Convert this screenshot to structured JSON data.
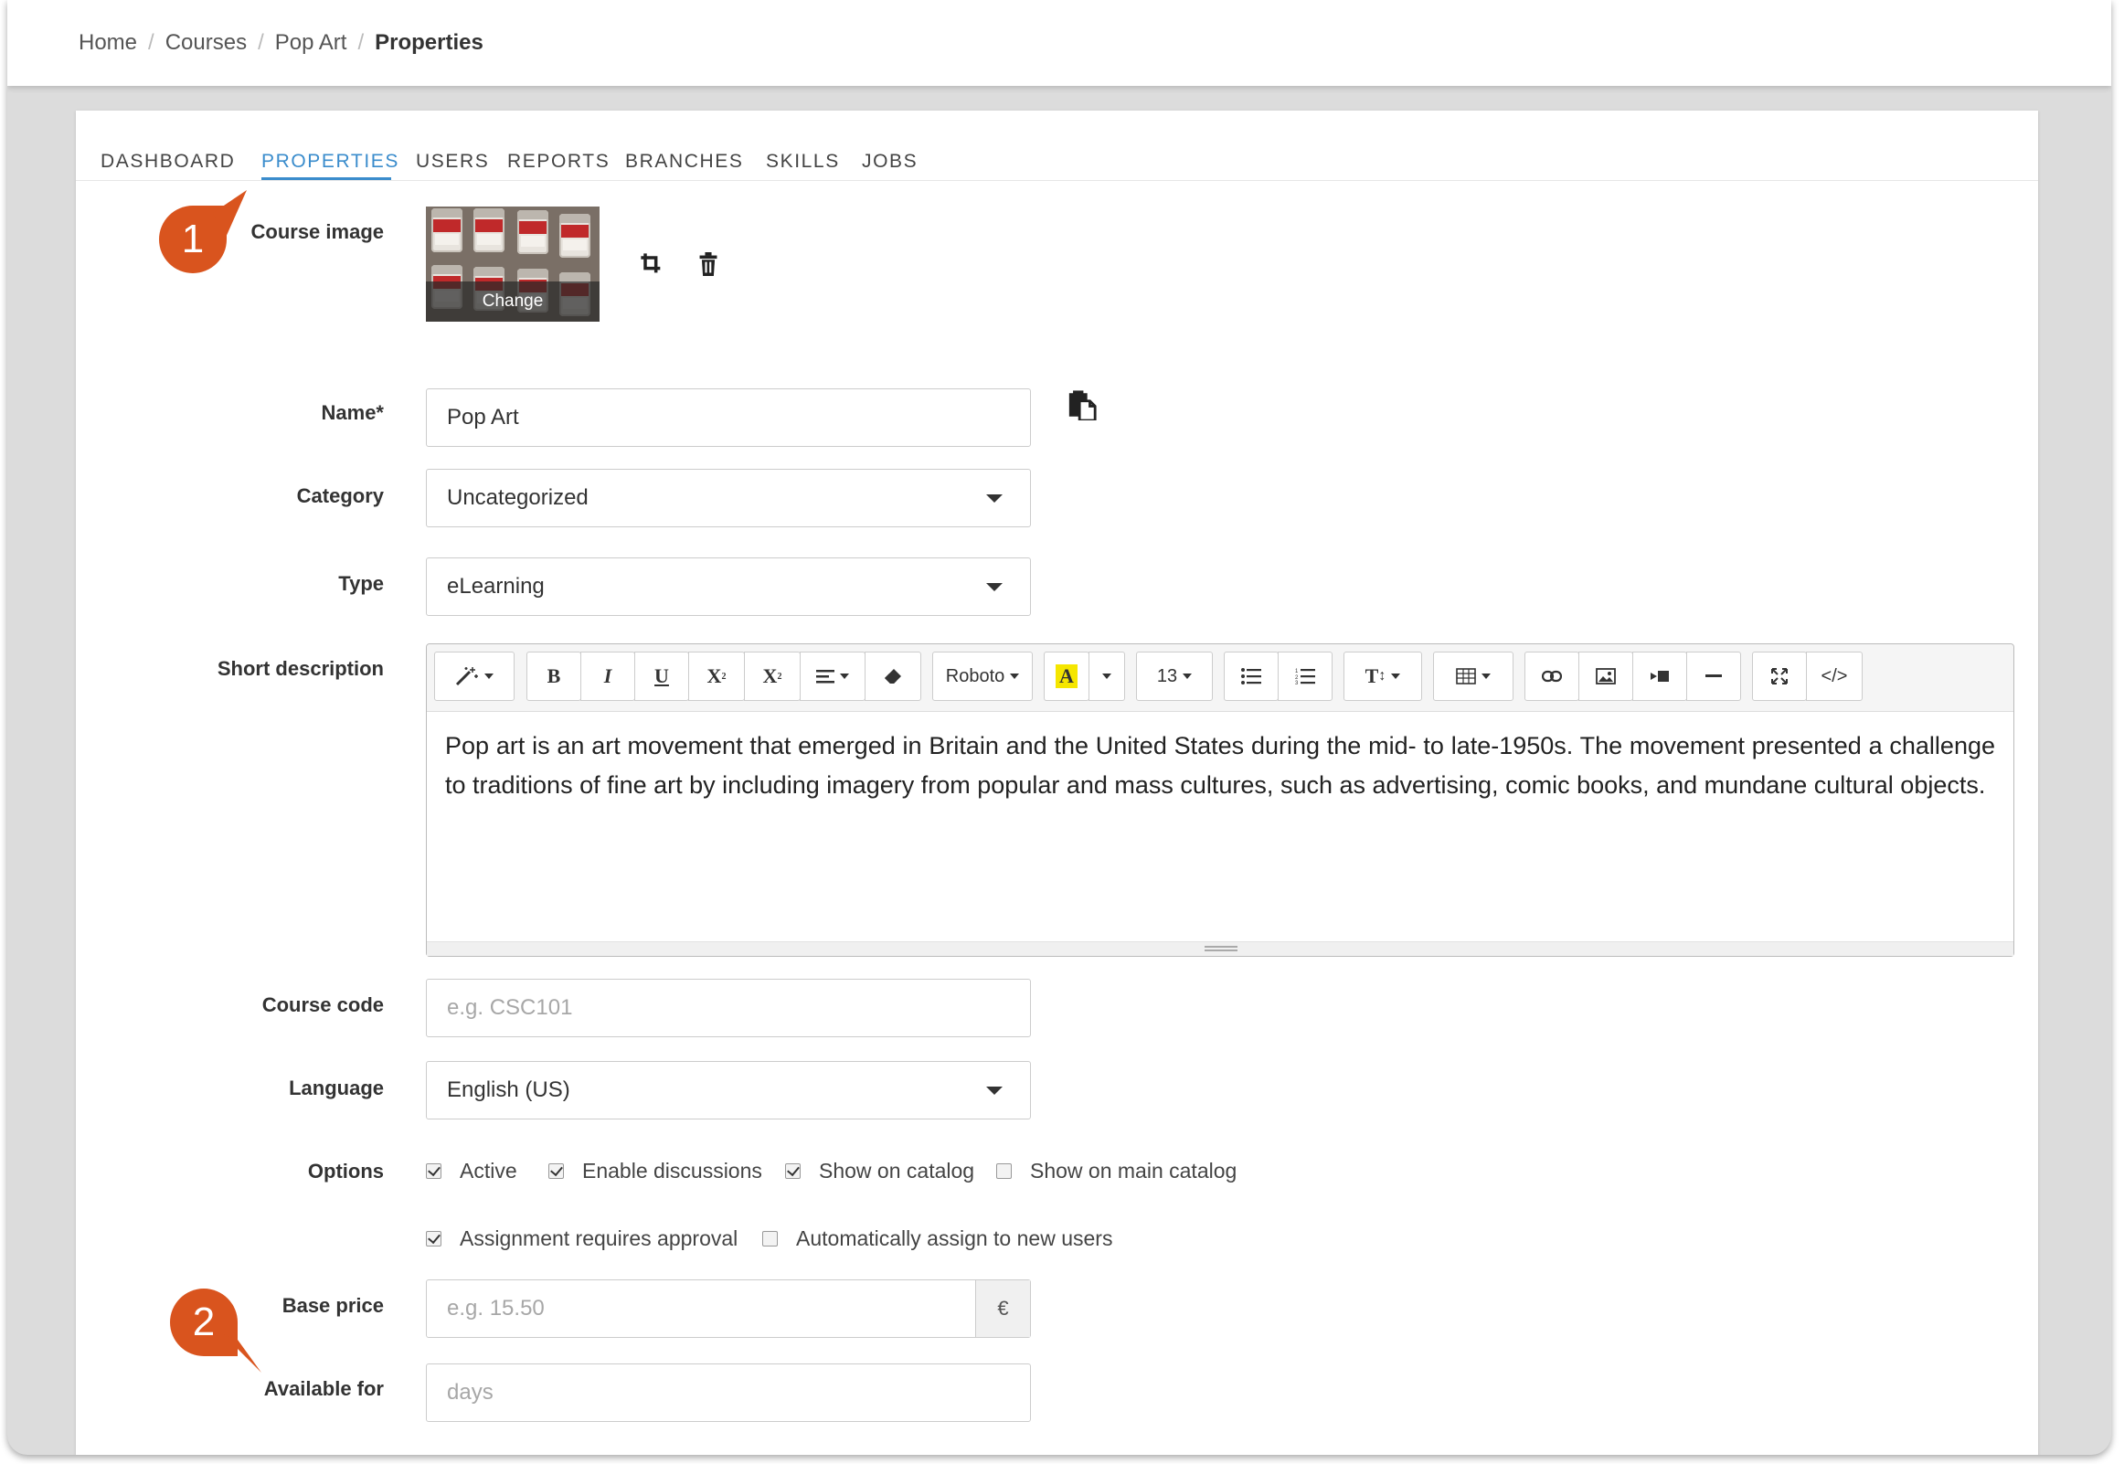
{
  "breadcrumb": {
    "items": [
      "Home",
      "Courses",
      "Pop Art"
    ],
    "current": "Properties",
    "separator": "/"
  },
  "tabs": [
    {
      "label": "DASHBOARD",
      "active": false
    },
    {
      "label": "PROPERTIES",
      "active": true
    },
    {
      "label": "USERS",
      "active": false
    },
    {
      "label": "REPORTS",
      "active": false
    },
    {
      "label": "BRANCHES",
      "active": false
    },
    {
      "label": "SKILLS",
      "active": false
    },
    {
      "label": "JOBS",
      "active": false
    }
  ],
  "callouts": [
    "1",
    "2"
  ],
  "form": {
    "course_image": {
      "label": "Course image",
      "change_label": "Change",
      "crop_icon": "crop-icon",
      "delete_icon": "trash-icon"
    },
    "name": {
      "label": "Name*",
      "value": "Pop Art",
      "paste_icon": "clipboard-icon"
    },
    "category": {
      "label": "Category",
      "value": "Uncategorized"
    },
    "type": {
      "label": "Type",
      "value": "eLearning"
    },
    "short_description": {
      "label": "Short description",
      "font": "Roboto",
      "font_size": "13",
      "text": "Pop art is an art movement that emerged in Britain and the United States during the mid- to late-1950s. The movement presented a challenge to traditions of fine art by including imagery from popular and mass cultures, such as advertising, comic books, and mundane cultural objects."
    },
    "course_code": {
      "label": "Course code",
      "placeholder": "e.g. CSC101"
    },
    "language": {
      "label": "Language",
      "value": "English (US)"
    },
    "options": {
      "label": "Options",
      "items": [
        {
          "label": "Active",
          "checked": true
        },
        {
          "label": "Enable discussions",
          "checked": true
        },
        {
          "label": "Show on catalog",
          "checked": true
        },
        {
          "label": "Show on main catalog",
          "checked": false
        },
        {
          "label": "Assignment requires approval",
          "checked": true
        },
        {
          "label": "Automatically assign to new users",
          "checked": false
        }
      ]
    },
    "base_price": {
      "label": "Base price",
      "placeholder": "e.g. 15.50",
      "currency": "€"
    },
    "available_for": {
      "label": "Available for",
      "placeholder": "days"
    }
  },
  "colors": {
    "accent": "#3a8ccc",
    "callout": "#d9541e",
    "highlight": "#f5e600"
  }
}
